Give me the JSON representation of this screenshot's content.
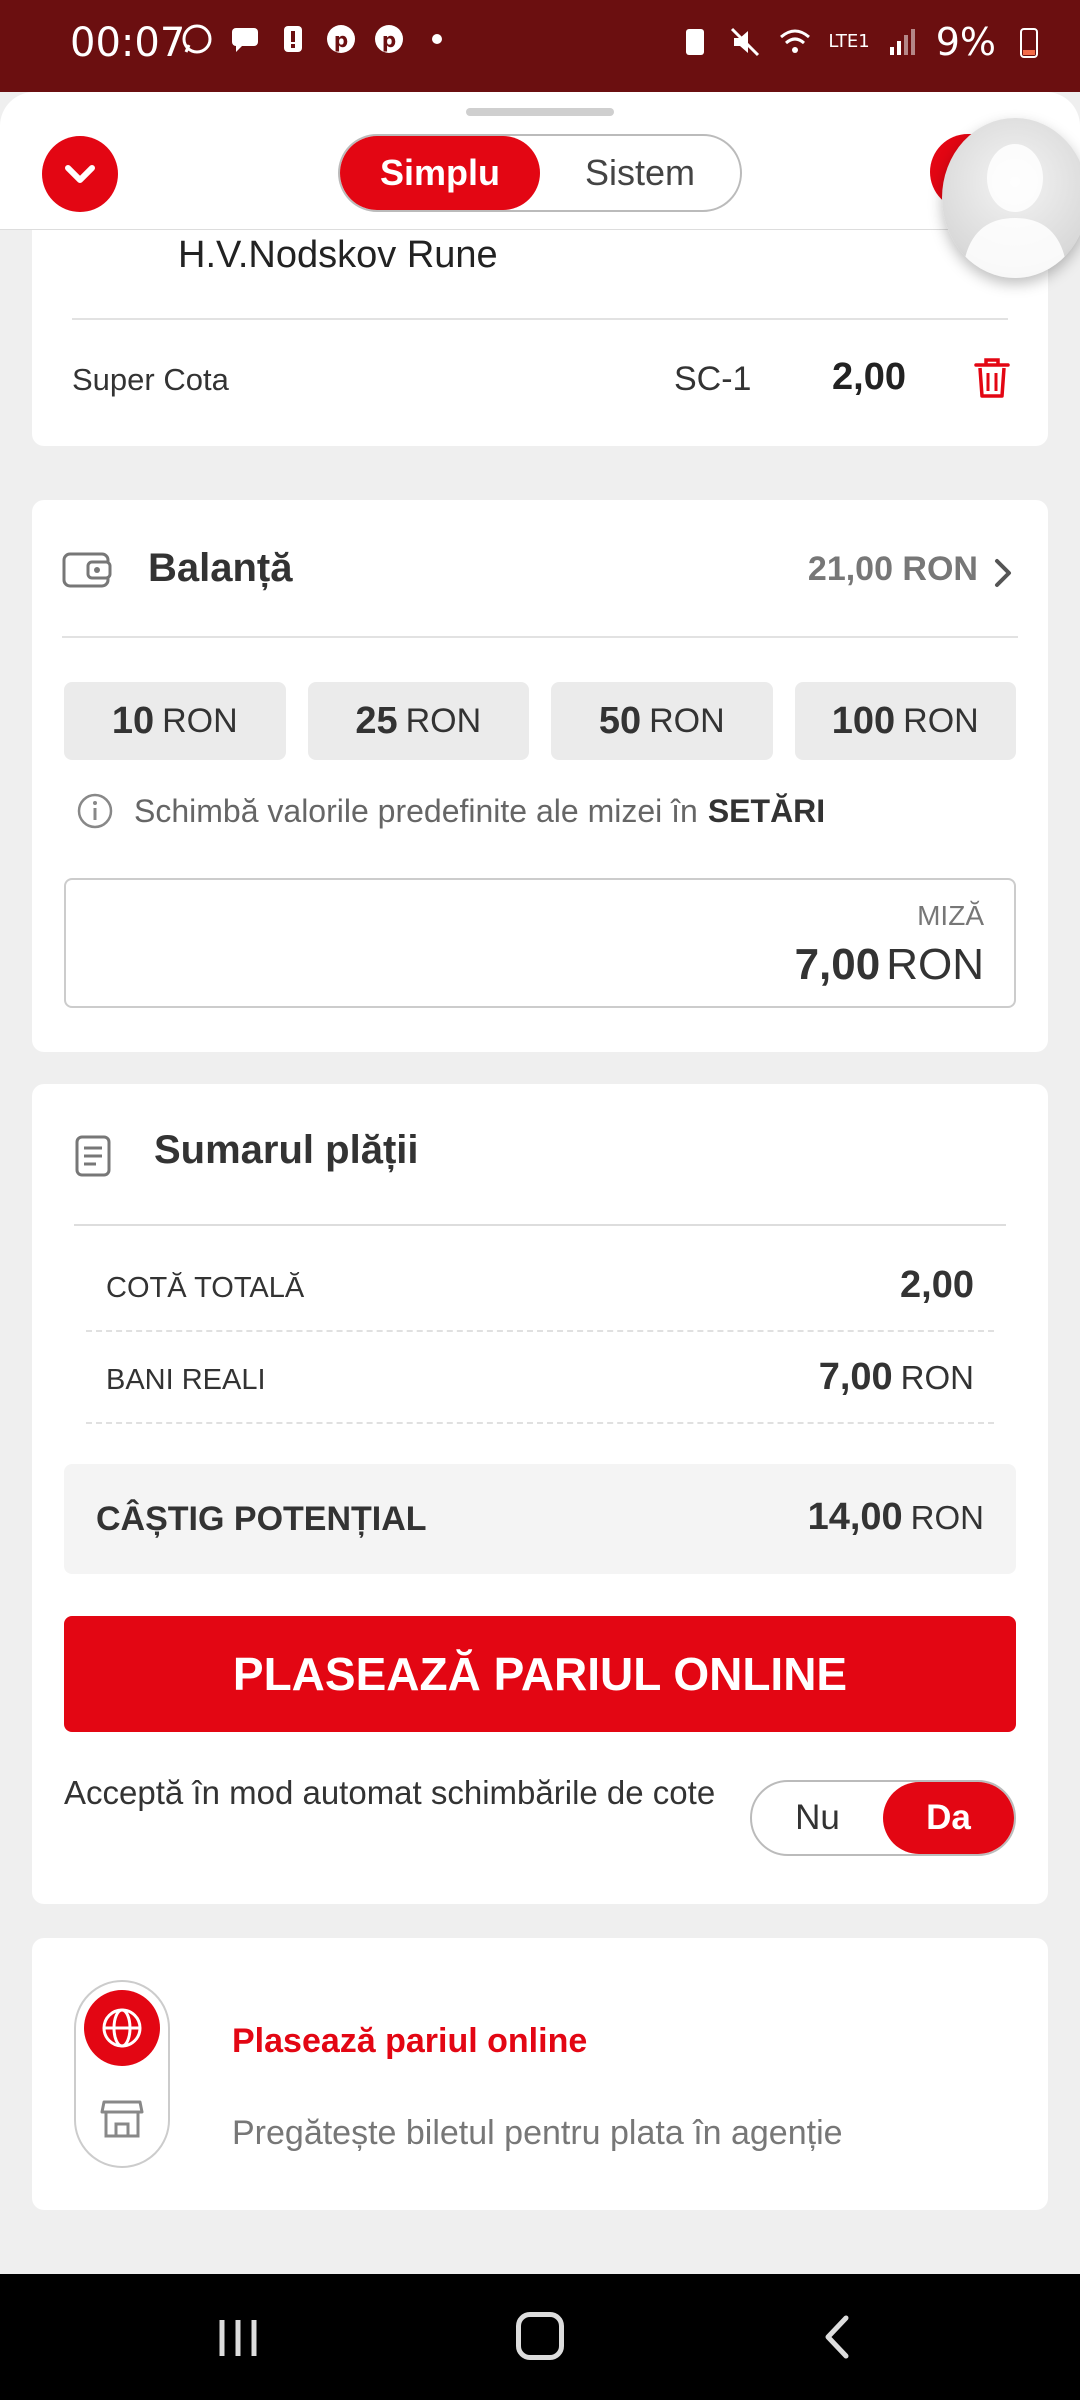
{
  "status_bar": {
    "time": "00:07",
    "battery": "9%",
    "network": "LTE1"
  },
  "header": {
    "tabs": [
      {
        "label": "Simplu",
        "active": true
      },
      {
        "label": "Sistem",
        "active": false
      }
    ]
  },
  "bet": {
    "selection": "H.V.Nodskov Rune",
    "market": "Super Cota",
    "code": "SC-1",
    "odds": "2,00"
  },
  "balance": {
    "title": "Balanță",
    "value": "21,00 RON",
    "quick_stakes": [
      {
        "amount": "10",
        "currency": "RON"
      },
      {
        "amount": "25",
        "currency": "RON"
      },
      {
        "amount": "50",
        "currency": "RON"
      },
      {
        "amount": "100",
        "currency": "RON"
      }
    ],
    "info_text": "Schimbă valorile predefinite ale mizei în",
    "info_link": "SETĂRI",
    "stake_label": "MIZĂ",
    "stake_amount": "7,00",
    "stake_currency": "RON"
  },
  "summary": {
    "title": "Sumarul plății",
    "rows": [
      {
        "label": "COTĂ TOTALĂ",
        "value": "2,00",
        "unit": ""
      },
      {
        "label": "BANI REALI",
        "value": "7,00",
        "unit": "RON"
      }
    ],
    "potential_label": "CÂȘTIG POTENȚIAL",
    "potential_value": "14,00",
    "potential_unit": "RON",
    "place_button": "PLASEAZĂ PARIUL ONLINE",
    "auto_accept_text": "Acceptă în mod automat schimbările de cote",
    "auto_accept_options": [
      {
        "label": "Nu",
        "active": false
      },
      {
        "label": "Da",
        "active": true
      }
    ]
  },
  "mode": {
    "online_label": "Plasează pariul online",
    "agency_label": "Pregătește biletul pentru plata în agenție"
  },
  "colors": {
    "accent": "#e30613",
    "status_bar": "#6b0f10"
  }
}
